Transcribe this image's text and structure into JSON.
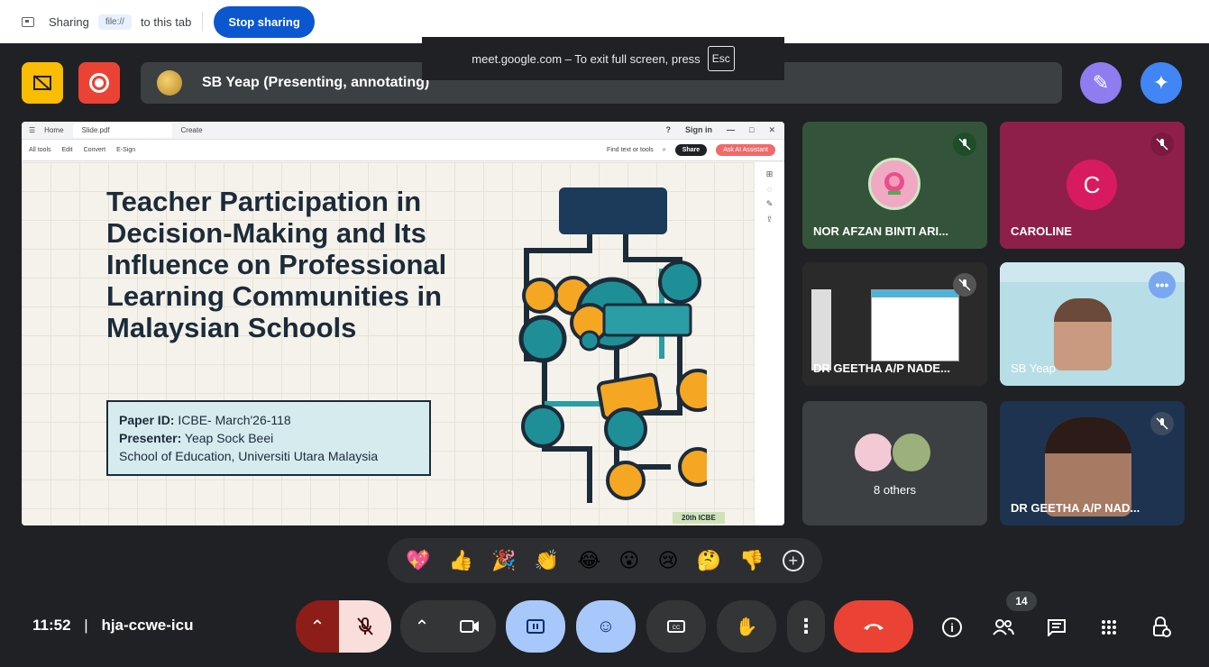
{
  "sharing_bar": {
    "sharing_label": "Sharing",
    "source_chip": "file://",
    "to_tab": "to this tab",
    "stop_button": "Stop sharing"
  },
  "fullscreen_toast": {
    "text": "meet.google.com – To exit full screen, press",
    "key": "Esc"
  },
  "presenter_bar": {
    "text": "SB Yeap (Presenting, annotating)"
  },
  "pdf_viewer": {
    "tabs": [
      "Home",
      "Slide.pdf",
      "Create"
    ],
    "sign_in": "Sign in",
    "toolbar": [
      "All tools",
      "Edit",
      "Convert",
      "E-Sign"
    ],
    "find_placeholder": "Find text or tools",
    "share_button": "Share",
    "acrobat_button": "Ask AI Assistant"
  },
  "slide": {
    "title": "Teacher Participation in Decision-Making and Its Influence on Professional Learning Communities in Malaysian Schools",
    "paper_id_label": "Paper ID:",
    "paper_id_value": " ICBE- March'26-118",
    "presenter_label": "Presenter:",
    "presenter_value": " Yeap Sock Beei",
    "school": "School of Education, Universiti Utara Malaysia",
    "badge": "20th ICBE"
  },
  "participants": [
    {
      "name": "NOR AFZAN BINTI ARI...",
      "muted": true
    },
    {
      "name": "CAROLINE",
      "initial": "C",
      "muted": true
    },
    {
      "name": "DR GEETHA A/P NADE...",
      "muted": true
    },
    {
      "name": "SB Yeap",
      "muted": false
    },
    {
      "name": "8 others"
    },
    {
      "name": "DR GEETHA A/P NAD...",
      "muted": true
    }
  ],
  "reactions": [
    "💖",
    "👍",
    "🎉",
    "👏",
    "😂",
    "😮",
    "😢",
    "🤔",
    "👎",
    "+"
  ],
  "bottom_bar": {
    "time": "11:52",
    "meeting_code": "hja-ccwe-icu",
    "people_count": "14"
  },
  "colors": {
    "stage_bg": "#202124",
    "stop_sharing": "#0b57d0",
    "hangup": "#ea4335",
    "mic_off_bg": "#f9dedc",
    "present_active": "#a8c7fa"
  }
}
